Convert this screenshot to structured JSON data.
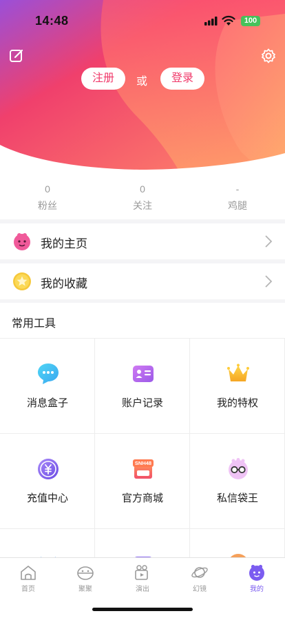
{
  "status_bar": {
    "time": "14:48",
    "battery": "100"
  },
  "header": {
    "register_label": "注册",
    "or_label": "或",
    "login_label": "登录",
    "colors": {
      "gradient_start": "#9b4fd8",
      "gradient_mid": "#f2406a",
      "gradient_end": "#ffa06a"
    }
  },
  "stats": [
    {
      "value": "0",
      "label": "粉丝"
    },
    {
      "value": "0",
      "label": "关注"
    },
    {
      "value": "-",
      "label": "鸡腿"
    }
  ],
  "links": [
    {
      "label": "我的主页",
      "icon": "pink-blob-icon"
    },
    {
      "label": "我的收藏",
      "icon": "star-coin-icon"
    }
  ],
  "tools": {
    "title": "常用工具",
    "items": [
      {
        "label": "消息盒子",
        "icon": "chat-bubble-icon"
      },
      {
        "label": "账户记录",
        "icon": "id-card-icon"
      },
      {
        "label": "我的特权",
        "icon": "crown-icon"
      },
      {
        "label": "充值中心",
        "icon": "recharge-coin-icon"
      },
      {
        "label": "官方商城",
        "icon": "shop-icon",
        "badge": "SNH48"
      },
      {
        "label": "私信袋王",
        "icon": "glasses-mascot-icon"
      }
    ]
  },
  "tabbar": {
    "active_color": "#7b5cf0",
    "items": [
      {
        "label": "首页",
        "icon": "home-icon"
      },
      {
        "label": "聚聚",
        "icon": "chat-ball-icon"
      },
      {
        "label": "演出",
        "icon": "video-camera-icon"
      },
      {
        "label": "幻镜",
        "icon": "planet-icon"
      },
      {
        "label": "我的",
        "icon": "profile-icon"
      }
    ]
  }
}
